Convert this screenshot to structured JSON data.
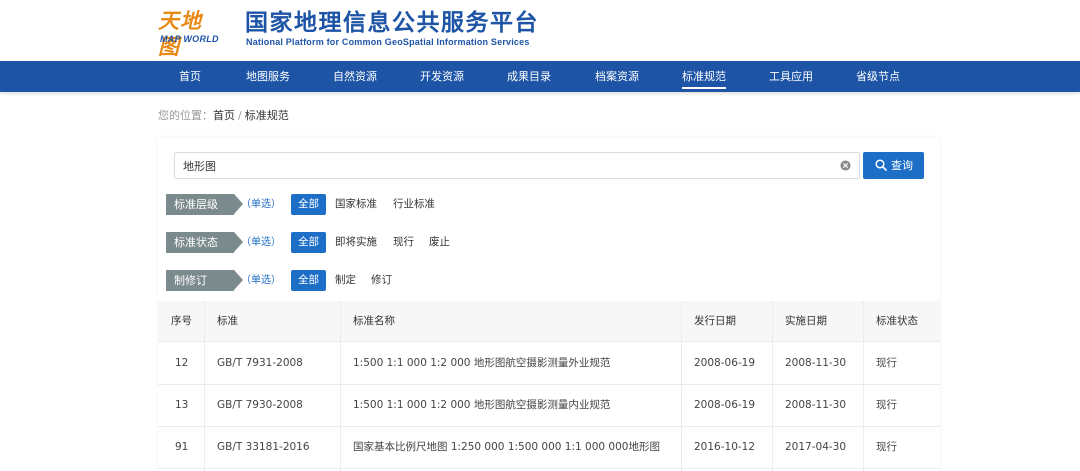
{
  "header": {
    "logo_cn": "天地图",
    "logo_en": "MAP WORLD",
    "title_cn": "国家地理信息公共服务平台",
    "title_en": "National Platform for Common GeoSpatial Information Services",
    "brand_color": "#1d54a6",
    "logo_color": "#e88a17"
  },
  "nav": {
    "items": [
      {
        "label": "首页"
      },
      {
        "label": "地图服务"
      },
      {
        "label": "自然资源"
      },
      {
        "label": "开发资源"
      },
      {
        "label": "成果目录"
      },
      {
        "label": "档案资源"
      },
      {
        "label": "标准规范",
        "active": true
      },
      {
        "label": "工具应用"
      },
      {
        "label": "省级节点"
      }
    ]
  },
  "breadcrumb": {
    "prefix": "您的位置：",
    "home": "首页",
    "separator": "/",
    "current": "标准规范"
  },
  "search": {
    "value": "地形图",
    "button_label": "查询",
    "button_icon": "search-icon",
    "clear_icon": "close-circle-icon"
  },
  "filters": [
    {
      "label": "标准层级",
      "mode": "（单选）",
      "options": [
        "全部",
        "国家标准",
        "行业标准"
      ],
      "selected": "全部"
    },
    {
      "label": "标准状态",
      "mode": "（单选）",
      "options": [
        "全部",
        "即将实施",
        "现行",
        "废止"
      ],
      "selected": "全部"
    },
    {
      "label": "制修订",
      "mode": "（单选）",
      "options": [
        "全部",
        "制定",
        "修订"
      ],
      "selected": "全部"
    }
  ],
  "table": {
    "columns": [
      "序号",
      "标准",
      "标准名称",
      "发行日期",
      "实施日期",
      "标准状态"
    ],
    "rows": [
      [
        "12",
        "GB/T 7931-2008",
        "1:500 1:1 000 1:2 000 地形图航空摄影测量外业规范",
        "2008-06-19",
        "2008-11-30",
        "现行"
      ],
      [
        "13",
        "GB/T 7930-2008",
        "1:500 1:1 000 1:2 000 地形图航空摄影测量内业规范",
        "2008-06-19",
        "2008-11-30",
        "现行"
      ],
      [
        "91",
        "GB/T 33181-2016",
        "国家基本比例尺地图 1:250 000 1:500 000 1:1 000 000地形图",
        "2016-10-12",
        "2017-04-30",
        "现行"
      ]
    ]
  },
  "colors": {
    "nav_bg": "#1d54a6",
    "accent": "#1d6ec6",
    "filter_tag_bg": "#7b8a8d"
  }
}
